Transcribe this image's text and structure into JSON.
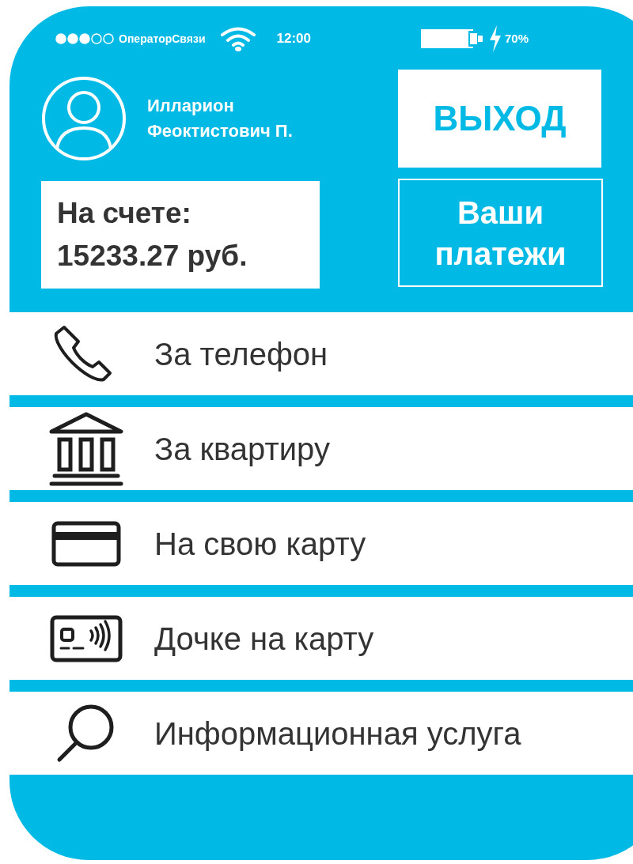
{
  "status_bar": {
    "operator": "ОператорСвязи",
    "time": "12:00",
    "battery": "70%"
  },
  "user": {
    "name_first": "Илларион",
    "name_rest": "Феоктистович П."
  },
  "logout_button": "ВЫХОД",
  "balance": {
    "label": "На счете:",
    "amount": "15233.27 руб."
  },
  "payments_button": "Ваши платежи",
  "menu": [
    {
      "kind": "phone",
      "label": "За телефон"
    },
    {
      "kind": "building",
      "label": "За квартиру"
    },
    {
      "kind": "card",
      "label": "На свою карту"
    },
    {
      "kind": "contactless",
      "label": "Дочке на карту"
    },
    {
      "kind": "search",
      "label": "Информационная услуга"
    }
  ]
}
